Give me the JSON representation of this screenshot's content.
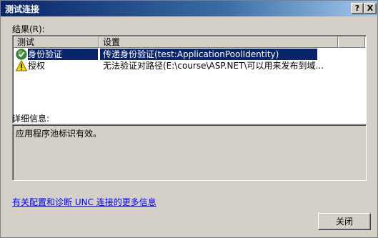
{
  "window": {
    "title": "测试连接",
    "help_label": "?",
    "close_label": "X"
  },
  "results": {
    "label": "结果(R):",
    "columns": [
      "测试",
      "设置"
    ],
    "rows": [
      {
        "icon": "success-check-icon",
        "test": "身份验证",
        "setting": "传递身份验证(test:ApplicationPoolIdentity)",
        "selected": true
      },
      {
        "icon": "warning-icon",
        "test": "授权",
        "setting": "无法验证对路径(E:\\course\\ASP.NET\\可以用来发布到域...",
        "selected": false
      }
    ]
  },
  "details": {
    "label": "详细信息:",
    "text": "应用程序池标识有效。"
  },
  "link": {
    "text": "有关配置和诊断 UNC 连接的更多信息"
  },
  "buttons": {
    "close": "关闭"
  },
  "colors": {
    "selection": "#0a246a",
    "link": "#0000ff",
    "face": "#d4d0c8"
  }
}
